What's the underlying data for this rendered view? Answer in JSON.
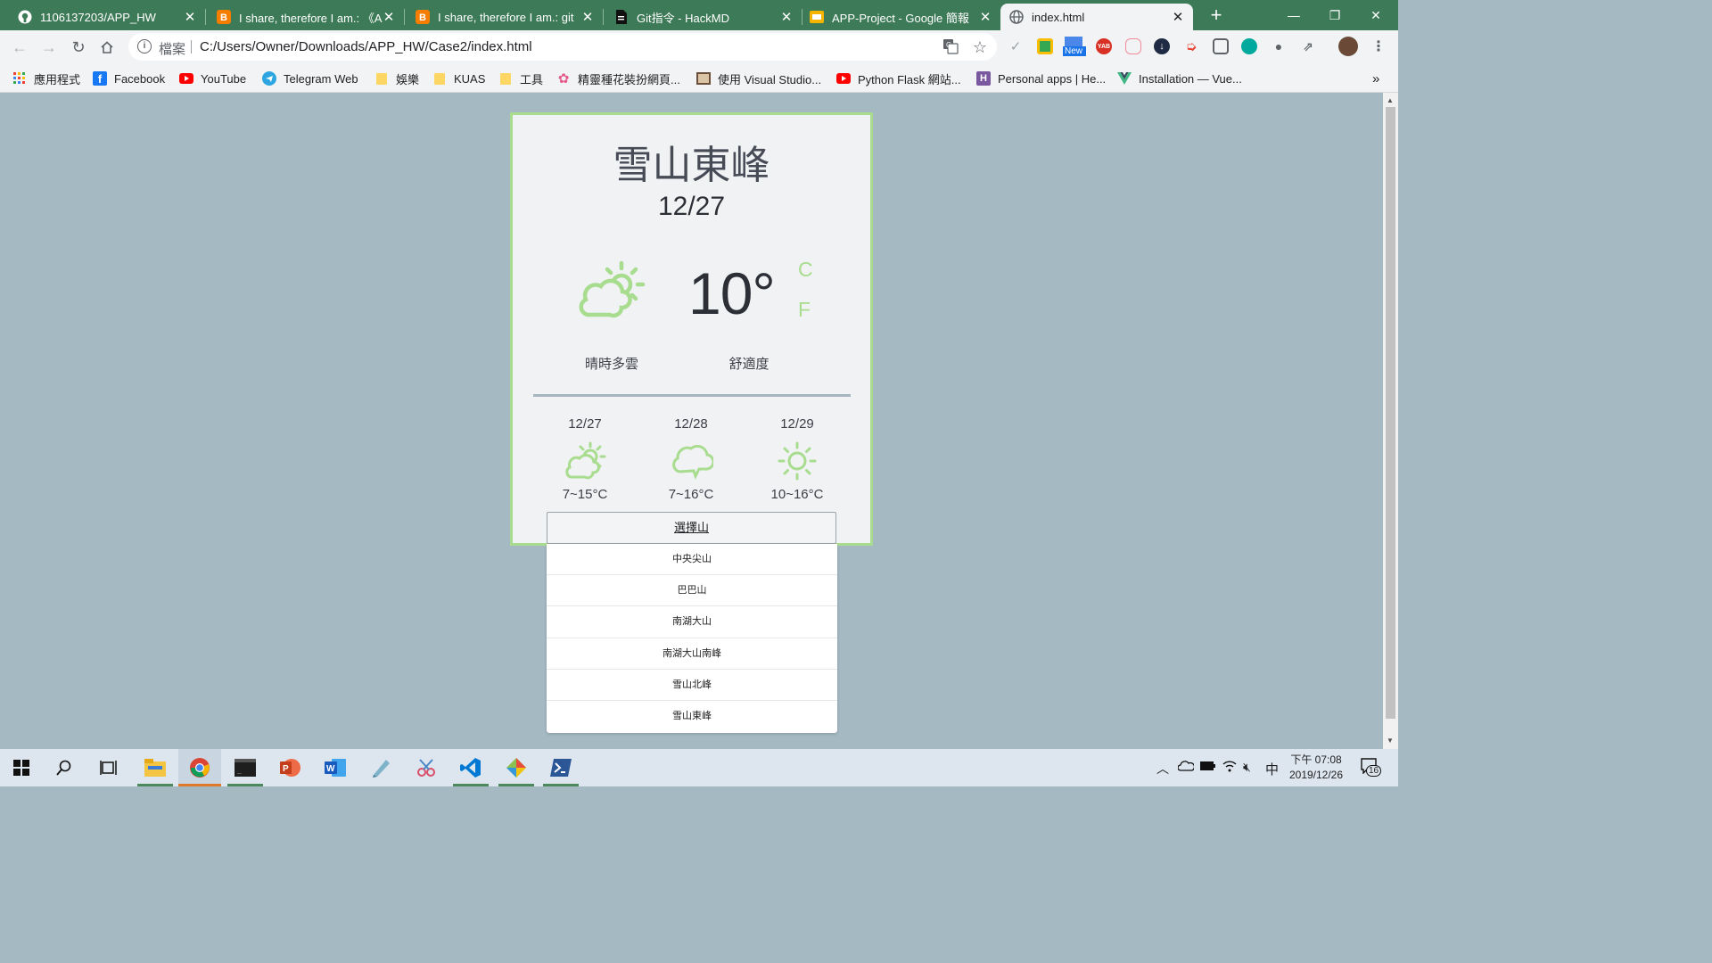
{
  "browser": {
    "tabs": [
      {
        "title": "1106137203/APP_HW",
        "icon": "github-icon"
      },
      {
        "title": "I share, therefore I am.: 《A",
        "icon": "blogger-icon"
      },
      {
        "title": "I share, therefore I am.: git",
        "icon": "blogger-icon"
      },
      {
        "title": "Git指令 - HackMD",
        "icon": "hackmd-icon"
      },
      {
        "title": "APP-Project - Google 簡報",
        "icon": "google-slides-icon"
      },
      {
        "title": "index.html",
        "icon": "globe-icon",
        "active": true
      }
    ],
    "new_tab": "+",
    "address": {
      "scheme": "檔案",
      "url": "C:/Users/Owner/Downloads/APP_HW/Case2/index.html"
    },
    "extensions": {
      "new_badge": "New",
      "yab": "YAB"
    },
    "bookmarks": [
      {
        "label": "應用程式",
        "icon": "apps-grid-icon"
      },
      {
        "label": "Facebook",
        "icon": "facebook-icon"
      },
      {
        "label": "YouTube",
        "icon": "youtube-icon"
      },
      {
        "label": "Telegram Web",
        "icon": "telegram-icon"
      },
      {
        "label": "娛樂",
        "icon": "folder-icon"
      },
      {
        "label": "KUAS",
        "icon": "folder-icon"
      },
      {
        "label": "工具",
        "icon": "folder-icon"
      },
      {
        "label": "精靈種花裝扮網頁...",
        "icon": "flower-icon"
      },
      {
        "label": "使用 Visual Studio...",
        "icon": "image-icon"
      },
      {
        "label": "Python Flask 網站...",
        "icon": "youtube-icon"
      },
      {
        "label": "Personal apps | He...",
        "icon": "heroku-icon"
      },
      {
        "label": "Installation — Vue...",
        "icon": "vue-icon"
      }
    ],
    "bookmarks_overflow": "»"
  },
  "weather": {
    "city": "雪山東峰",
    "date": "12/27",
    "temperature": "10°",
    "units": {
      "c": "C",
      "f": "F"
    },
    "condition": "晴時多雲",
    "comfort": "舒適度",
    "accent_color": "#a8dc8e",
    "forecast": [
      {
        "date": "12/27",
        "range": "7~15°C",
        "icon": "partly-cloudy-icon"
      },
      {
        "date": "12/28",
        "range": "7~16°C",
        "icon": "cloud-icon"
      },
      {
        "date": "12/29",
        "range": "10~16°C",
        "icon": "sun-icon"
      }
    ]
  },
  "mountain_select": {
    "selected": "選擇山",
    "options": [
      "中央尖山",
      "巴巴山",
      "南湖大山",
      "南湖大山南峰",
      "雪山北峰",
      "雪山東峰"
    ]
  },
  "taskbar": {
    "clock": {
      "period_time": "下午 07:08",
      "date": "2019/12/26"
    },
    "ime": "中",
    "notifications": "16"
  }
}
